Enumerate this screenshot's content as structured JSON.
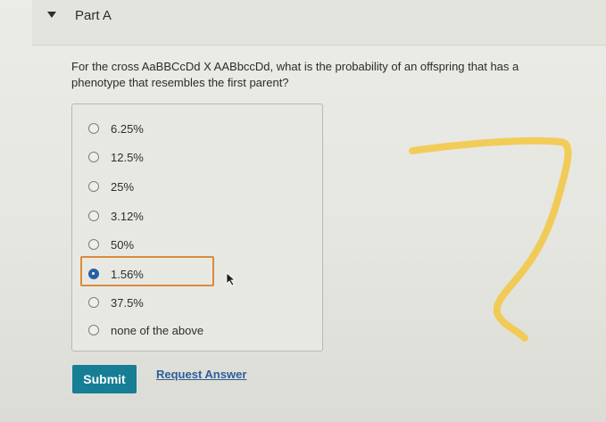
{
  "part": {
    "title": "Part A"
  },
  "question": {
    "text": "For the cross AaBBCcDd X AABbccDd, what is the probability of an offspring that has a phenotype that resembles the first parent?"
  },
  "options": [
    {
      "label": "6.25%",
      "selected": false
    },
    {
      "label": "12.5%",
      "selected": false
    },
    {
      "label": "25%",
      "selected": false
    },
    {
      "label": "3.12%",
      "selected": false
    },
    {
      "label": "50%",
      "selected": false
    },
    {
      "label": "1.56%",
      "selected": true
    },
    {
      "label": "37.5%",
      "selected": false
    },
    {
      "label": "none of the above",
      "selected": false
    }
  ],
  "actions": {
    "submit_label": "Submit",
    "request_answer_label": "Request Answer"
  },
  "colors": {
    "submit_bg": "#167e95",
    "link": "#2d5e9b",
    "selected_radio": "#2a5fa8",
    "selection_outline": "#d98b3b",
    "annotation": "#f2c94c"
  }
}
